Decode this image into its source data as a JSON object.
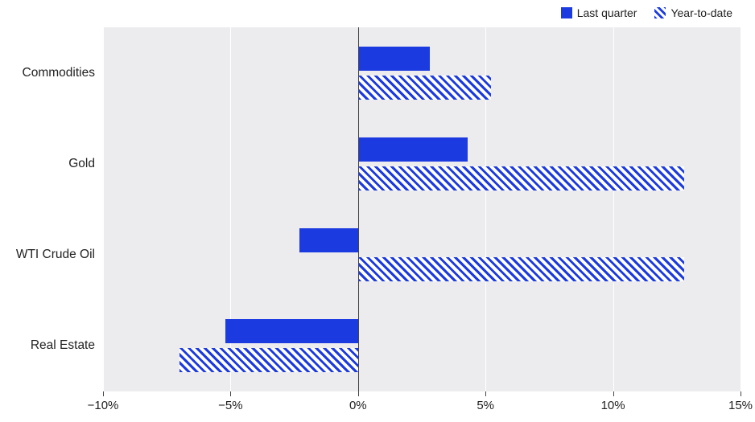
{
  "chart_data": {
    "type": "bar",
    "orientation": "horizontal",
    "categories": [
      "Commodities",
      "Gold",
      "WTI Crude Oil",
      "Real Estate"
    ],
    "series": [
      {
        "name": "Last quarter",
        "style": "solid",
        "values": [
          2.8,
          4.3,
          -2.3,
          -5.2
        ]
      },
      {
        "name": "Year-to-date",
        "style": "hatch",
        "values": [
          5.2,
          12.8,
          12.8,
          -7.0
        ]
      }
    ],
    "xlim": [
      -10,
      15
    ],
    "x_ticks": [
      -10,
      -5,
      0,
      5,
      10,
      15
    ],
    "x_tick_labels": [
      "−10%",
      "−5%",
      "0%",
      "5%",
      "10%",
      "15%"
    ],
    "xlabel": "",
    "ylabel": "",
    "title": ""
  }
}
